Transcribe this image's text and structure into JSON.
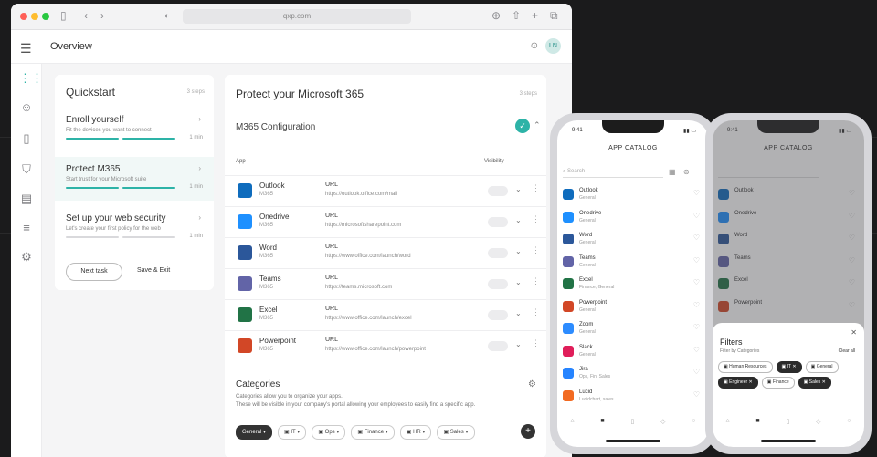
{
  "browser": {
    "url": "qxp.com"
  },
  "header": {
    "title": "Overview",
    "avatar": "LN"
  },
  "sidebar": {
    "icons": [
      "grid-icon",
      "user-icon",
      "phone-icon",
      "shield-icon",
      "table-icon",
      "list-icon",
      "settings-icon"
    ]
  },
  "quickstart": {
    "title": "Quickstart",
    "steps": "3 steps",
    "items": [
      {
        "title": "Enroll yourself",
        "desc": "Fit the devices you want to connect",
        "time": "1 min"
      },
      {
        "title": "Protect M365",
        "desc": "Start trust for your Microsoft suite",
        "time": "1 min"
      },
      {
        "title": "Set up your web security",
        "desc": "Let's create your first policy for the web",
        "time": "1 min"
      }
    ],
    "btn_next": "Next task",
    "btn_save": "Save & Exit"
  },
  "main": {
    "title": "Protect your Microsoft 365",
    "steps": "3 steps",
    "config_label": "M365 Configuration",
    "col_app": "App",
    "col_visibility": "Visibility",
    "apps": [
      {
        "name": "Outlook",
        "sub": "M365",
        "url_label": "URL",
        "url": "https://outlook.office.com/mail",
        "color": "#0f6cbd"
      },
      {
        "name": "Onedrive",
        "sub": "M365",
        "url_label": "URL",
        "url": "https://microsoftsharepoint.com",
        "color": "#1e90ff"
      },
      {
        "name": "Word",
        "sub": "M365",
        "url_label": "URL",
        "url": "https://www.office.com/launch/word",
        "color": "#2b579a"
      },
      {
        "name": "Teams",
        "sub": "M365",
        "url_label": "URL",
        "url": "https://teams.microsoft.com",
        "color": "#6264a7"
      },
      {
        "name": "Excel",
        "sub": "M365",
        "url_label": "URL",
        "url": "https://www.office.com/launch/excel",
        "color": "#217346"
      },
      {
        "name": "Powerpoint",
        "sub": "M365",
        "url_label": "URL",
        "url": "https://www.office.com/launch/powerpoint",
        "color": "#d24726"
      }
    ],
    "categories_title": "Categories",
    "categories_desc1": "Categories allow you to organize your apps.",
    "categories_desc2": "These will be visible in your company's portal allowing your employees to easily find a specific app.",
    "chips": [
      "General",
      "IT",
      "Ops",
      "Finance",
      "HR",
      "Sales"
    ]
  },
  "phone1": {
    "time": "9:41",
    "title": "APP CATALOG",
    "search": "Search",
    "apps": [
      {
        "name": "Outlook",
        "sub": "General",
        "color": "#0f6cbd"
      },
      {
        "name": "Onedrive",
        "sub": "General",
        "color": "#1e90ff"
      },
      {
        "name": "Word",
        "sub": "General",
        "color": "#2b579a"
      },
      {
        "name": "Teams",
        "sub": "General",
        "color": "#6264a7"
      },
      {
        "name": "Excel",
        "sub": "Finance, General",
        "color": "#217346"
      },
      {
        "name": "Powerpoint",
        "sub": "General",
        "color": "#d24726"
      },
      {
        "name": "Zoom",
        "sub": "General",
        "color": "#2d8cff"
      },
      {
        "name": "Slack",
        "sub": "General",
        "color": "#e01e5a"
      },
      {
        "name": "Jira",
        "sub": "Ops, Fin, Sales",
        "color": "#2684ff"
      },
      {
        "name": "Lucid",
        "sub": "Lucidchart, sales",
        "color": "#f26a21"
      }
    ]
  },
  "phone2": {
    "time": "9:41",
    "title": "APP CATALOG",
    "sheet_title": "Filters",
    "sheet_desc": "Filter by Categories",
    "sheet_action": "Clear all",
    "chips": [
      "Human Resources",
      "IT",
      "General",
      "Engineer",
      "Finance",
      "Sales"
    ]
  }
}
